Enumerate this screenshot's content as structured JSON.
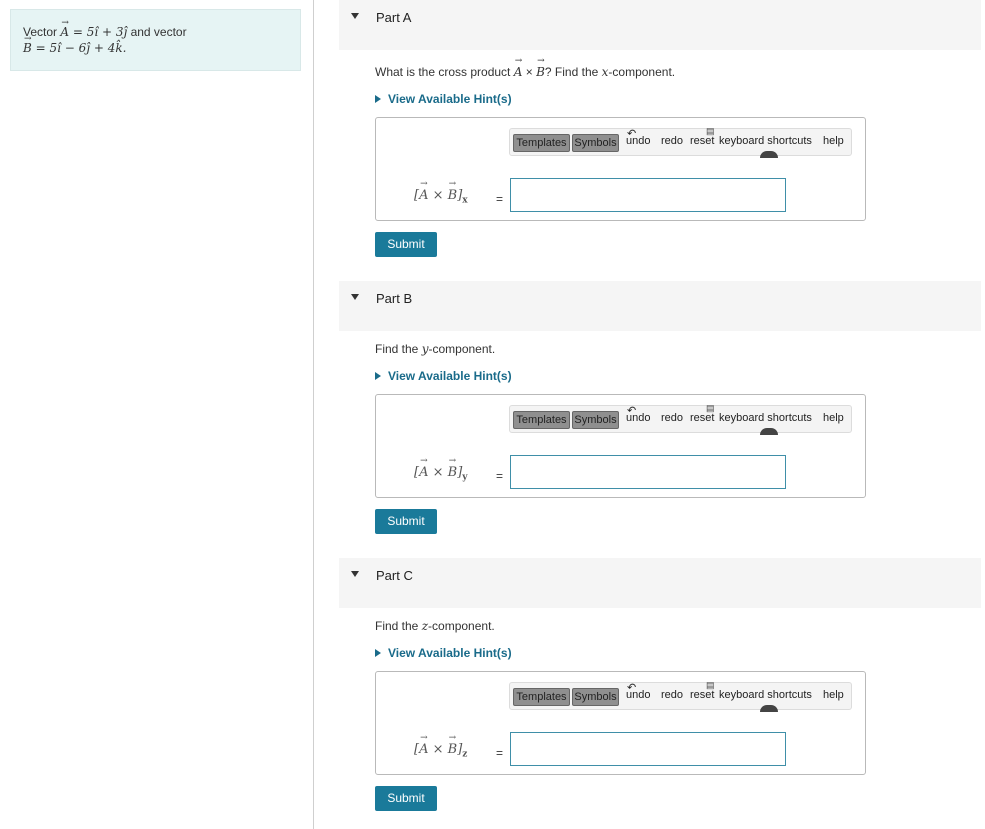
{
  "problem": {
    "prefix": "Vector ",
    "A_sym": "A",
    "A_rhs": " = 5î + 3ĵ",
    "mid": " and vector",
    "B_sym": "B",
    "B_rhs": " = 5î − 6ĵ + 4k̂."
  },
  "toolbar": {
    "templates": "Templates",
    "symbols": "Symbols",
    "undo": "undo",
    "redo": "redo",
    "reset": "reset",
    "shortcuts": "keyboard shortcuts",
    "help": "help"
  },
  "hint_label": "View Available Hint(s)",
  "submit_label": "Submit",
  "equals": "=",
  "parts": [
    {
      "title": "Part A",
      "q_pre": "What is the cross product ",
      "q_A": "A",
      "q_times": " × ",
      "q_B": "B",
      "q_post": "? Find the ",
      "q_var": "x",
      "q_end": "-component.",
      "expr_A": "A",
      "expr_B": "B",
      "expr_sub": "x"
    },
    {
      "title": "Part B",
      "q_pre": "Find the ",
      "q_var": "y",
      "q_end": "-component.",
      "expr_A": "A",
      "expr_B": "B",
      "expr_sub": "y"
    },
    {
      "title": "Part C",
      "q_pre": "Find the ",
      "q_var": "z",
      "q_end": "-component.",
      "expr_A": "A",
      "expr_B": "B",
      "expr_sub": "z"
    }
  ],
  "colors": {
    "accent": "#1a7a9a",
    "problem_bg": "#e6f4f4",
    "header_bg": "#f5f5f5",
    "hint": "#1a6b8a"
  }
}
